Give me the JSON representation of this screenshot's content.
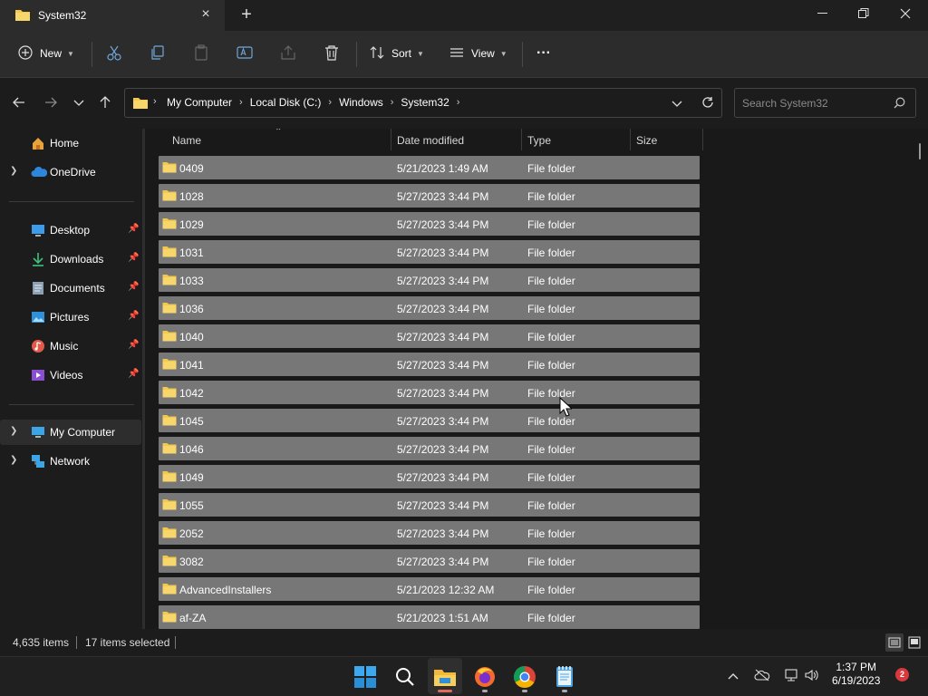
{
  "window": {
    "tab_title": "System32",
    "tab_close": "×",
    "new_tab": "+"
  },
  "toolbar": {
    "new_label": "New",
    "sort_label": "Sort",
    "view_label": "View",
    "more_label": "···"
  },
  "address": {
    "breadcrumbs": [
      "My Computer",
      "Local Disk (C:)",
      "Windows",
      "System32"
    ],
    "search_placeholder": "Search System32"
  },
  "sidebar": {
    "items": [
      {
        "label": "Home",
        "icon": "home-icon"
      },
      {
        "label": "OneDrive",
        "icon": "cloud-icon"
      },
      {
        "label": "Desktop",
        "icon": "desktop-icon"
      },
      {
        "label": "Downloads",
        "icon": "download-icon"
      },
      {
        "label": "Documents",
        "icon": "document-icon"
      },
      {
        "label": "Pictures",
        "icon": "picture-icon"
      },
      {
        "label": "Music",
        "icon": "music-icon"
      },
      {
        "label": "Videos",
        "icon": "video-icon"
      },
      {
        "label": "My Computer",
        "icon": "computer-icon"
      },
      {
        "label": "Network",
        "icon": "network-icon"
      }
    ]
  },
  "columns": {
    "name": "Name",
    "date": "Date modified",
    "type": "Type",
    "size": "Size"
  },
  "files": [
    {
      "name": "0409",
      "date": "5/21/2023 1:49 AM",
      "type": "File folder"
    },
    {
      "name": "1028",
      "date": "5/27/2023 3:44 PM",
      "type": "File folder"
    },
    {
      "name": "1029",
      "date": "5/27/2023 3:44 PM",
      "type": "File folder"
    },
    {
      "name": "1031",
      "date": "5/27/2023 3:44 PM",
      "type": "File folder"
    },
    {
      "name": "1033",
      "date": "5/27/2023 3:44 PM",
      "type": "File folder"
    },
    {
      "name": "1036",
      "date": "5/27/2023 3:44 PM",
      "type": "File folder"
    },
    {
      "name": "1040",
      "date": "5/27/2023 3:44 PM",
      "type": "File folder"
    },
    {
      "name": "1041",
      "date": "5/27/2023 3:44 PM",
      "type": "File folder"
    },
    {
      "name": "1042",
      "date": "5/27/2023 3:44 PM",
      "type": "File folder"
    },
    {
      "name": "1045",
      "date": "5/27/2023 3:44 PM",
      "type": "File folder"
    },
    {
      "name": "1046",
      "date": "5/27/2023 3:44 PM",
      "type": "File folder"
    },
    {
      "name": "1049",
      "date": "5/27/2023 3:44 PM",
      "type": "File folder"
    },
    {
      "name": "1055",
      "date": "5/27/2023 3:44 PM",
      "type": "File folder"
    },
    {
      "name": "2052",
      "date": "5/27/2023 3:44 PM",
      "type": "File folder"
    },
    {
      "name": "3082",
      "date": "5/27/2023 3:44 PM",
      "type": "File folder"
    },
    {
      "name": "AdvancedInstallers",
      "date": "5/21/2023 12:32 AM",
      "type": "File folder"
    },
    {
      "name": "af-ZA",
      "date": "5/21/2023 1:51 AM",
      "type": "File folder"
    }
  ],
  "status": {
    "item_count": "4,635 items",
    "selected_count": "17 items selected"
  },
  "taskbar": {
    "time": "1:37 PM",
    "date": "6/19/2023",
    "notification_count": "2"
  },
  "colors": {
    "folder": "#f2c94c",
    "selection": "#777777",
    "accent": "#0078d4"
  }
}
